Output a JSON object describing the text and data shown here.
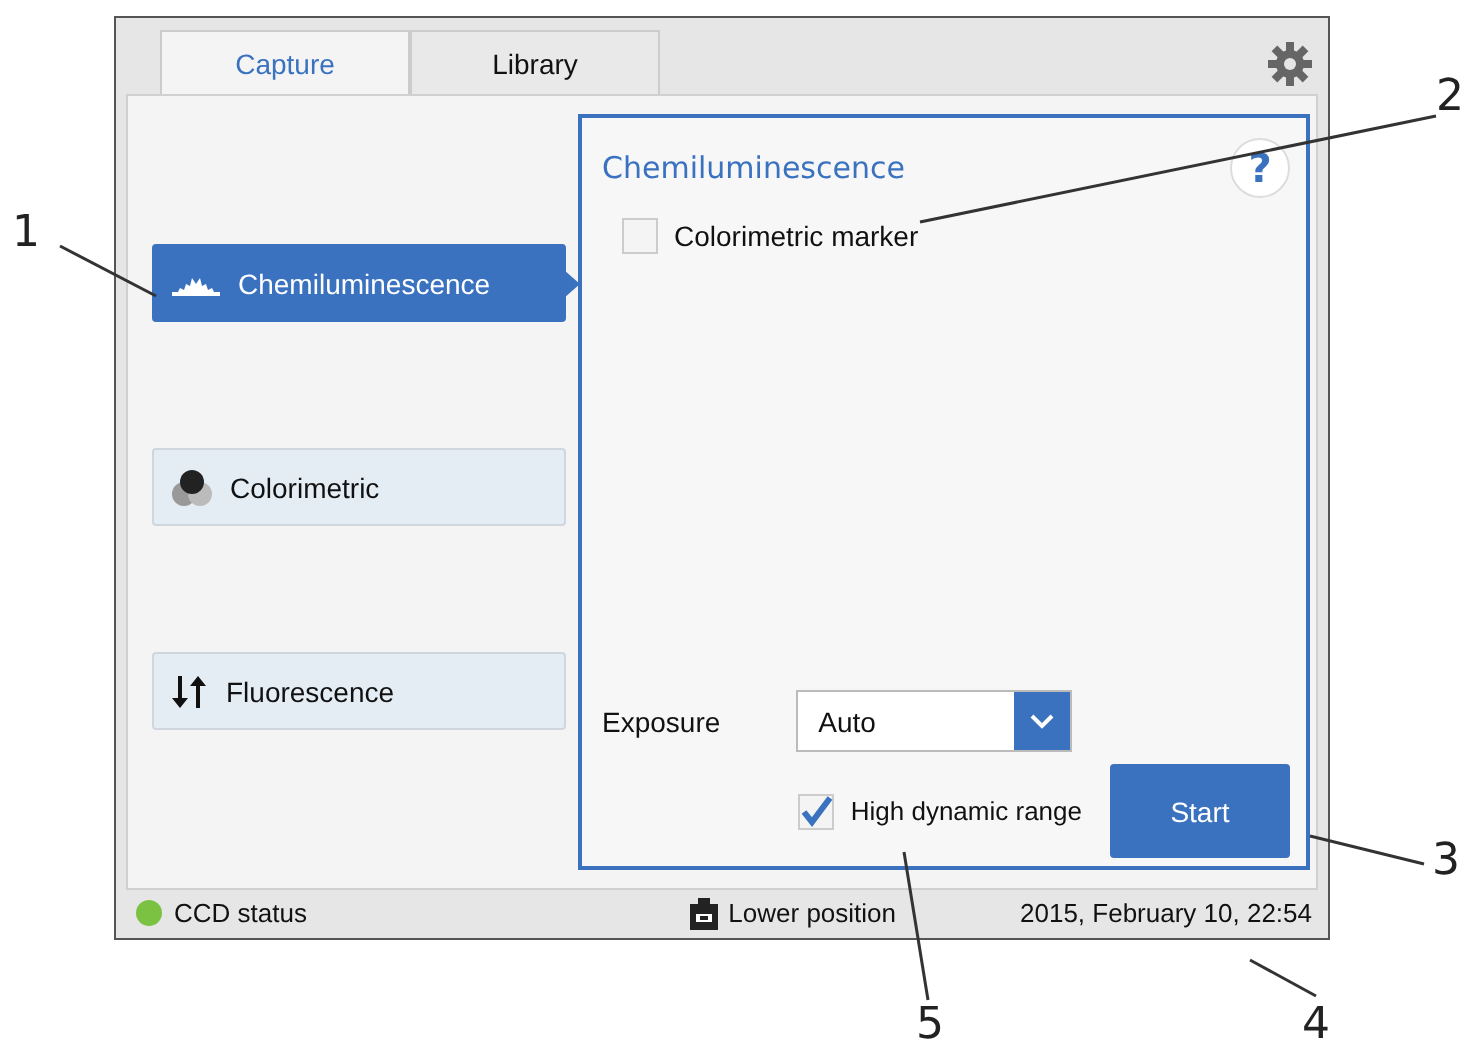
{
  "tabs": [
    {
      "label": "Capture",
      "selected": true
    },
    {
      "label": "Library",
      "selected": false
    }
  ],
  "modes": [
    {
      "label": "Chemiluminescence",
      "selected": true
    },
    {
      "label": "Colorimetric",
      "selected": false
    },
    {
      "label": "Fluorescence",
      "selected": false
    }
  ],
  "panel": {
    "title": "Chemiluminescence",
    "help": "?",
    "colorimetric_marker": {
      "label": "Colorimetric marker",
      "checked": false
    },
    "exposure": {
      "label": "Exposure",
      "value": "Auto"
    },
    "high_dynamic_range": {
      "label": "High dynamic range",
      "checked": true
    },
    "start_button": "Start"
  },
  "status_bar": {
    "ccd_status": {
      "label": "CCD status",
      "color": "#7cc242"
    },
    "position": "Lower position",
    "datetime": "2015, February 10, 22:54"
  },
  "callouts": [
    "1",
    "2",
    "3",
    "4",
    "5"
  ]
}
